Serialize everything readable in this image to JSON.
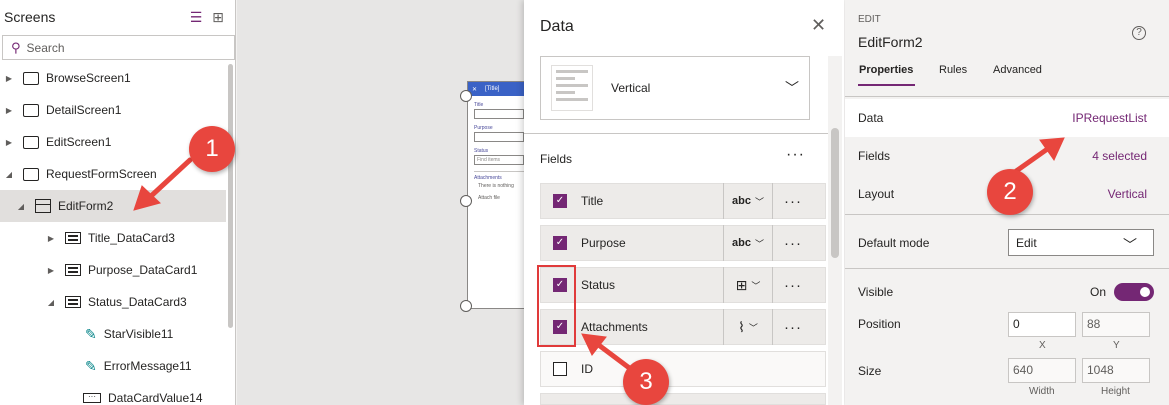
{
  "screens_panel": {
    "title": "Screens",
    "search_placeholder": "Search",
    "tree": [
      {
        "label": "BrowseScreen1",
        "type": "screen"
      },
      {
        "label": "DetailScreen1",
        "type": "screen"
      },
      {
        "label": "EditScreen1",
        "type": "screen"
      },
      {
        "label": "RequestFormScreen",
        "type": "screen"
      },
      {
        "label": "EditForm2",
        "type": "form"
      },
      {
        "label": "Title_DataCard3",
        "type": "card"
      },
      {
        "label": "Purpose_DataCard1",
        "type": "card"
      },
      {
        "label": "Status_DataCard3",
        "type": "card"
      },
      {
        "label": "StarVisible11",
        "type": "icon"
      },
      {
        "label": "ErrorMessage11",
        "type": "icon"
      },
      {
        "label": "DataCardValue14",
        "type": "input"
      }
    ]
  },
  "mini_form": {
    "title": "[Title]",
    "labels": [
      "Title",
      "Purpose",
      "Status",
      "Attachments"
    ],
    "status_placeholder": "Find items",
    "attachments_note": "There is nothing",
    "attach_file": "Attach file"
  },
  "data_panel": {
    "title": "Data",
    "layout_label": "Vertical",
    "fields_label": "Fields",
    "fields": [
      {
        "name": "Title",
        "checked": true,
        "control": "abc"
      },
      {
        "name": "Purpose",
        "checked": true,
        "control": "abc"
      },
      {
        "name": "Status",
        "checked": true,
        "control": "combo"
      },
      {
        "name": "Attachments",
        "checked": true,
        "control": "attach"
      },
      {
        "name": "ID",
        "checked": false,
        "control": ""
      }
    ]
  },
  "properties": {
    "kind": "EDIT",
    "control_name": "EditForm2",
    "tabs": [
      "Properties",
      "Rules",
      "Advanced"
    ],
    "data_label": "Data",
    "data_value": "IPRequestList",
    "fields_label": "Fields",
    "fields_value": "4 selected",
    "layout_label": "Layout",
    "layout_value": "Vertical",
    "default_mode_label": "Default mode",
    "default_mode_value": "Edit",
    "visible_label": "Visible",
    "visible_value": "On",
    "position_label": "Position",
    "position_x": "0",
    "position_y": "88",
    "x_label": "X",
    "y_label": "Y",
    "size_label": "Size",
    "size_width": "640",
    "size_height": "1048",
    "width_label": "Width",
    "height_label": "Height"
  },
  "annotations": {
    "badge1": "1",
    "badge2": "2",
    "badge3": "3"
  },
  "colors": {
    "accent": "#742774",
    "annotation_red": "#e8463e"
  }
}
